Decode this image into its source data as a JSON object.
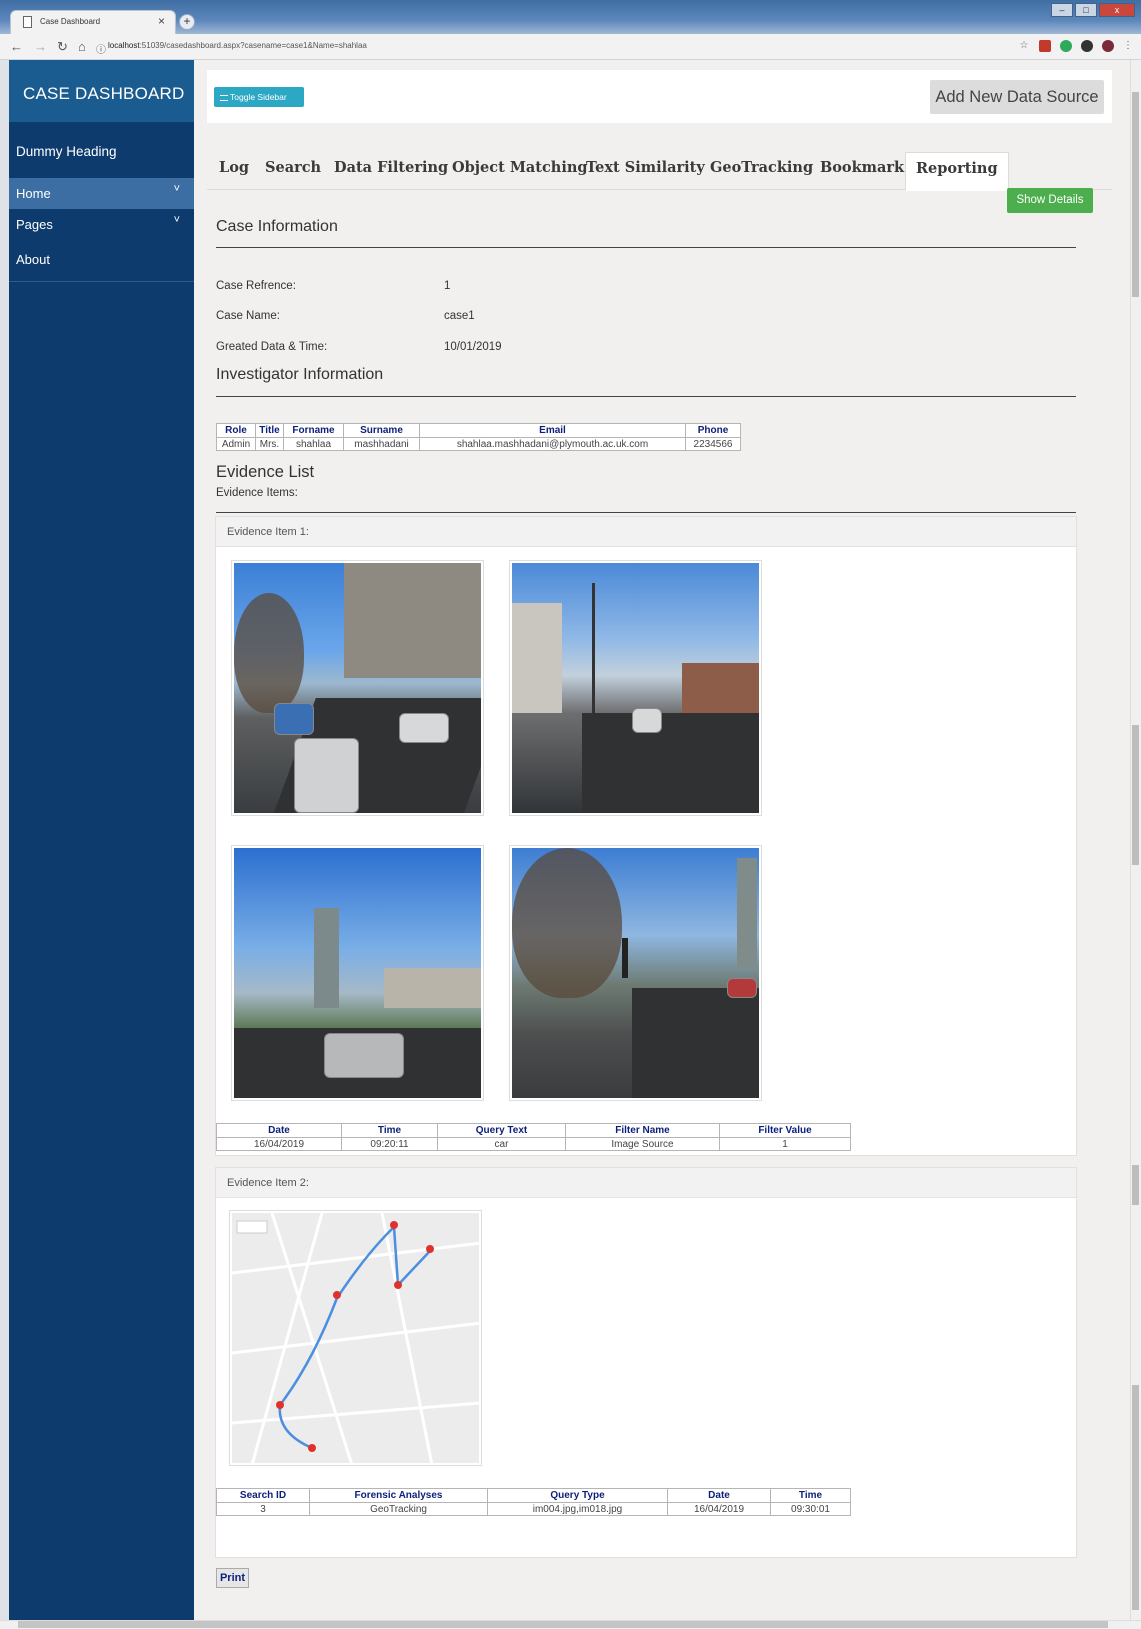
{
  "browser": {
    "tab_title": "Case Dashboard",
    "tab_close": "×",
    "new_tab": "+",
    "url_host": "localhost",
    "url_rest": ":51039/casedashboard.aspx?casename=case1&Name=shahlaa",
    "win_min": "–",
    "win_max": "□",
    "win_close": "x"
  },
  "sidebar": {
    "brand": "CASE DASHBOARD",
    "heading": "Dummy Heading",
    "items": [
      {
        "label": "Home",
        "chevron": "˅"
      },
      {
        "label": "Pages",
        "chevron": "˅"
      }
    ],
    "about": "About"
  },
  "toolbar": {
    "toggle_label": "Toggle Sidebar",
    "add_source_label": "Add New Data Source"
  },
  "tabs": [
    "Log",
    "Search",
    "Data Filtering",
    "Object Matching",
    "Text Similarity",
    "GeoTracking",
    "Bookmark",
    "Reporting"
  ],
  "active_tab": "Reporting",
  "show_details": "Show Details",
  "case_info": {
    "title": "Case Information",
    "fields": [
      {
        "label": "Case Refrence:",
        "value": "1"
      },
      {
        "label": "Case Name:",
        "value": "case1"
      },
      {
        "label": "Greated Data & Time:",
        "value": "10/01/2019"
      }
    ]
  },
  "investigator": {
    "title": "Investigator Information",
    "headers": [
      "Role",
      "Title",
      "Forname",
      "Surname",
      "Email",
      "Phone"
    ],
    "row": [
      "Admin",
      "Mrs.",
      "shahlaa",
      "mashhadani",
      "shahlaa.mashhadani@plymouth.ac.uk.com",
      "2234566"
    ]
  },
  "evidence": {
    "title": "Evidence List",
    "subtitle": "Evidence Items:",
    "item1": {
      "header": "Evidence Item 1:",
      "table_headers": [
        "Date",
        "Time",
        "Query Text",
        "Filter Name",
        "Filter Value"
      ],
      "table_row": [
        "16/04/2019",
        "09:20:11",
        "car",
        "Image Source",
        "1"
      ]
    },
    "item2": {
      "header": "Evidence Item 2:",
      "table_headers": [
        "Search ID",
        "Forensic Analyses",
        "Query Type",
        "Date",
        "Time"
      ],
      "table_row": [
        "3",
        "GeoTracking",
        "im004.jpg,im018.jpg",
        "16/04/2019",
        "09:30:01"
      ]
    }
  },
  "print_label": "Print",
  "colors": {
    "sidebar": "#0e3b6e",
    "brand": "#1b5c90",
    "toggle": "#2da8c4",
    "show_details": "#4cae4c",
    "table_header_text": "#0c1f7a"
  }
}
